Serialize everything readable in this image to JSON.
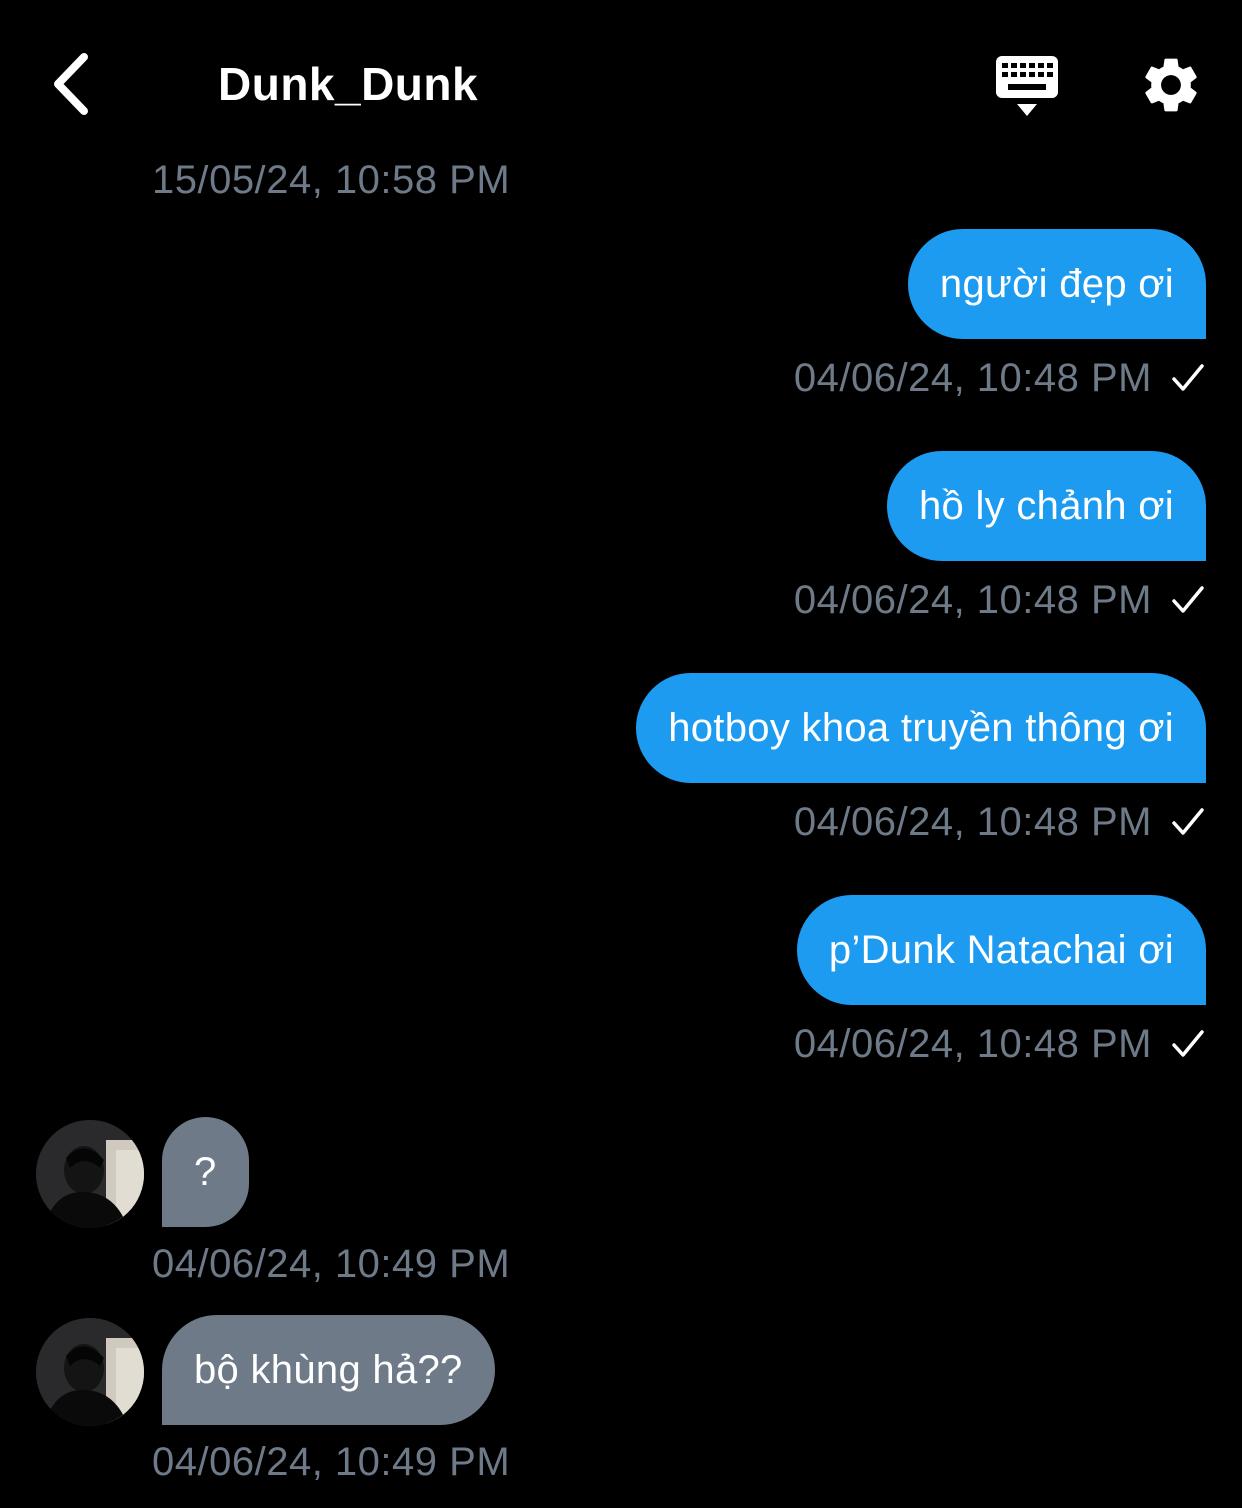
{
  "header": {
    "title": "Dunk_Dunk",
    "back_icon": "chevron-left-icon",
    "keyboard_icon": "keyboard-icon",
    "settings_icon": "gear-icon"
  },
  "clipped_timestamp": "15/05/24, 10:58 PM",
  "messages": [
    {
      "direction": "outgoing",
      "text": "người đẹp ơi",
      "timestamp": "04/06/24, 10:48 PM",
      "status": "sent"
    },
    {
      "direction": "outgoing",
      "text": "hồ ly chảnh ơi",
      "timestamp": "04/06/24, 10:48 PM",
      "status": "sent"
    },
    {
      "direction": "outgoing",
      "text": "hotboy khoa truyền thông ơi",
      "timestamp": "04/06/24, 10:48 PM",
      "status": "sent"
    },
    {
      "direction": "outgoing",
      "text": "p’Dunk Natachai ơi",
      "timestamp": "04/06/24, 10:48 PM",
      "status": "sent"
    },
    {
      "direction": "incoming",
      "text": "?",
      "timestamp": "04/06/24, 10:49 PM"
    },
    {
      "direction": "incoming",
      "text": "bộ khùng hả??",
      "timestamp": "04/06/24, 10:49 PM"
    }
  ],
  "colors": {
    "background": "#000000",
    "outgoing_bubble": "#1d9bf0",
    "incoming_bubble": "#6e7a88",
    "timestamp": "#6e7a88",
    "text": "#ffffff"
  }
}
